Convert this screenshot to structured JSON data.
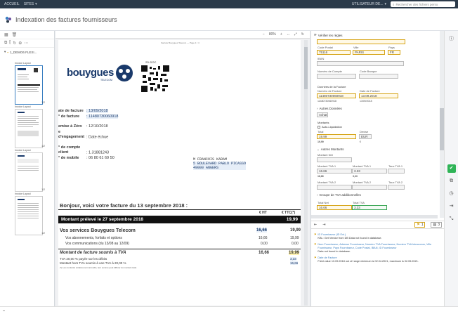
{
  "topbar": {
    "home": "ACCUEIL",
    "sites": "SITES",
    "user": "UTILISATEUR DE...",
    "search_placeholder": "Rechercher des fichiers perso"
  },
  "header": {
    "title": "Indexation des factures fournisseurs"
  },
  "left": {
    "tree_label": "1_DEMO6 FLEXI...",
    "pages": [
      {
        "label": "Invoice Layout",
        "num": "1/2"
      },
      {
        "label": "Invoice Layout",
        "num": "1/2"
      },
      {
        "label": "Invoice Layout",
        "num": "1/2"
      },
      {
        "label": "Invoice Layout",
        "num": "1/2"
      }
    ]
  },
  "doc_toolbar": {
    "zoom": "80%",
    "page": "1 / 4"
  },
  "invoice": {
    "header_small": "Facture Bouygues Telecom — Page 1 / 4",
    "brand": "bouygues",
    "brand_sub": "TELECOM",
    "qr_label": "2D-DOC",
    "rows": [
      {
        "label": "ate de facture",
        "value": ": 13/09/2018"
      },
      {
        "label": "° de facture",
        "value": ": 11480730060918"
      },
      {
        "label": "emise à Zéro",
        "value": ": 12/10/2018"
      },
      {
        "label": "e d'engagement",
        "value": ": Date échue"
      },
      {
        "label": "° de compte client",
        "value": ": 1.31881243"
      },
      {
        "label": "° de mobile",
        "value": ": 06 80 61 69 50"
      }
    ],
    "address": [
      "M FRANCOIS KARAM",
      "5 BOULEVARD PABLO PICASSO",
      "49000 ANGERS"
    ],
    "greeting": "Bonjour, voici votre facture du 13 septembre 2018 :",
    "col_ht": "€ HT",
    "col_ttc": "€ TTC(*)",
    "prelev_label": "Montant prélevé le 27 septembre 2018",
    "prelev_value": "19,99",
    "services_label": "Vos services Bouygues Telecom",
    "services_ht": "16,66",
    "services_ttc": "19,99",
    "sub1_label": "Vos abonnements, forfaits et options",
    "sub1_ht": "16,66",
    "sub1_ttc": "19,99",
    "sub2_label": "Vos communications (du 13/08 au 12/09)",
    "sub2_ht": "0,00",
    "sub2_ttc": "0,00",
    "tva_label": "Montant de facture soumis à TVA",
    "tva_ht": "16,66",
    "tva_ttc": "19,99",
    "tva_line1": "TVA 20,00 % payée sur les débits",
    "tva_line1_val": "3,33",
    "tva_line2": "Montant hors TVA soumis à une TVA à 20,00 %",
    "tva_line2_val": "16,66",
    "footnote": "(*) Les montants unitaires sont arrondis, leur somme peut différer du montant total."
  },
  "form": {
    "verify": "Vérifier les règles",
    "code_postal_lbl": "Code Postal",
    "code_postal": "75116",
    "ville_lbl": "Ville",
    "ville": "PARIS",
    "pays_lbl": "Pays",
    "pays": "FR",
    "iban_lbl": "IBAN",
    "num_compte_lbl": "Numéro de Compte",
    "code_banque_lbl": "Code Banque",
    "facture_section": "Données de la Facture",
    "num_facture_lbl": "Numéro de Facture",
    "num_facture": "11480730060918",
    "num_facture_ocr": "11480730060918",
    "date_facture_lbl": "Date de Facture",
    "date_facture": "13.09.2018",
    "date_facture_ocr": "13/09/2018",
    "autres_donnees": "Autres Données",
    "achat": "Achat",
    "montants": "Montants",
    "autoliq": "Auto-Liquidation",
    "total_lbl": "Total",
    "total": "19.99",
    "total_ocr": "19,99",
    "devise_lbl": "Devise",
    "devise": "EUR",
    "devise_ocr": "€",
    "autres_montants": "Autres Montants",
    "montant_net": "Montant Net",
    "montant_tva1": "Montant TVA 1",
    "mtva1_val": "16.66",
    "mtva1_ocr": "16,66",
    "montant_tva_1b": "Montant TVA 1",
    "mtva1b_val": "3.33",
    "mtva1b_ocr": "3,33",
    "taux_tva1": "Taux TVA 1",
    "montant_tva2": "Montant TVA 2",
    "montant_tva2b": "Montant TVA 2",
    "taux_tva2": "Taux TVA 2",
    "groupe_tva": "Groupe de TVA additionnelles",
    "total_net_lbl": "Total Net",
    "total_net": "16.66",
    "total_tva_lbl": "Total TVA",
    "total_tva": "3.33",
    "msg_count": "1",
    "msg_count2": "3",
    "messages": [
      {
        "title": "ID Fournisseur (ID Ext.)",
        "body": "KBL: Get Vendor from DB Data not found in database."
      },
      {
        "title": "Nom Fournisseur, Adresse Fournisseur, Numéro TVA Fournisseur, Numéro TVA Intracomm, Ville Fournisseur, Pays Fournisseur, Code Postal, IBAN, ID Fournisseur",
        "body": "Data not found in database."
      },
      {
        "title": "Date de Facture",
        "body": "Field value 13.09.2018 out of range minimum is 02.04.2021, maximum is 02.05.2021."
      }
    ]
  },
  "colors": {
    "accent": "#2fb457",
    "topbar": "#2b3a4a",
    "highlight": "#d6a417"
  }
}
